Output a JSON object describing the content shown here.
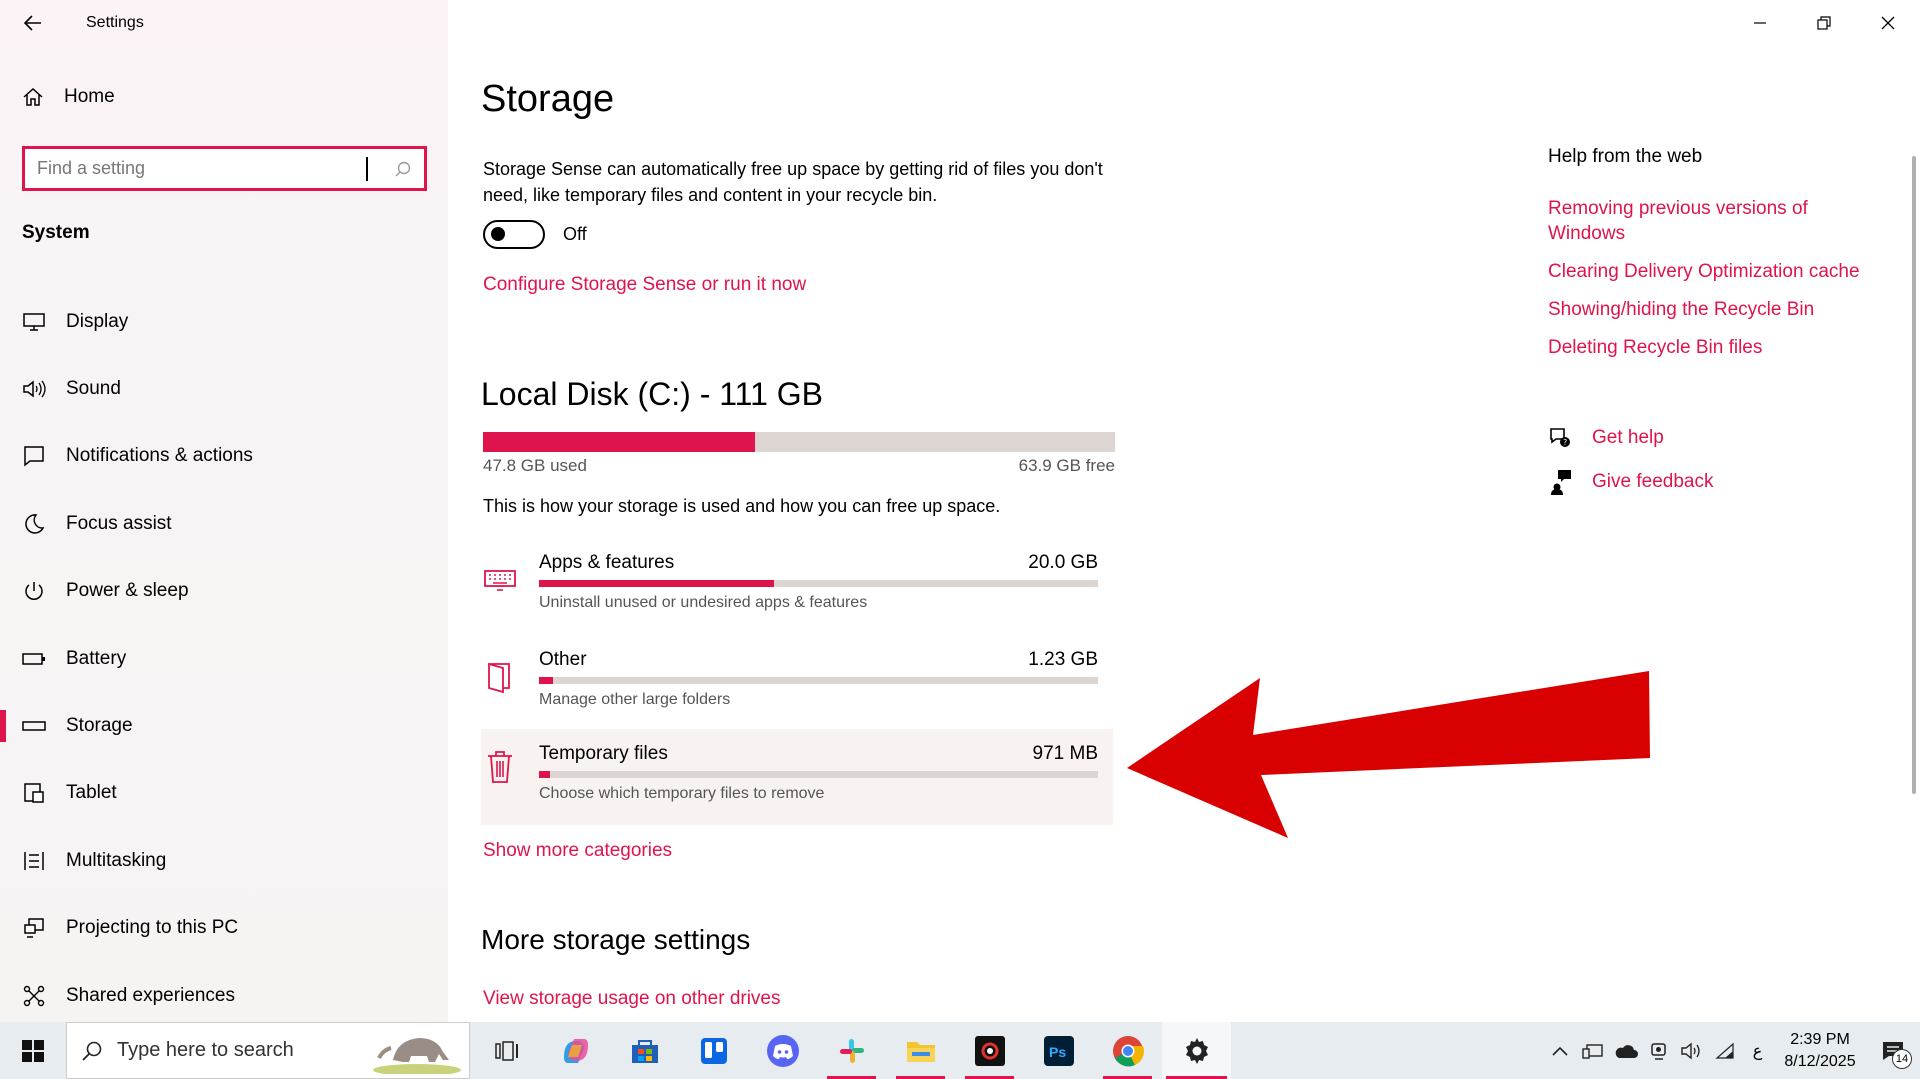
{
  "window": {
    "title": "Settings"
  },
  "sidebar": {
    "home_label": "Home",
    "search_placeholder": "Find a setting",
    "section_title": "System",
    "items": [
      {
        "label": "Display",
        "icon": "monitor-icon"
      },
      {
        "label": "Sound",
        "icon": "speaker-icon"
      },
      {
        "label": "Notifications & actions",
        "icon": "notification-icon"
      },
      {
        "label": "Focus assist",
        "icon": "moon-icon"
      },
      {
        "label": "Power & sleep",
        "icon": "power-icon"
      },
      {
        "label": "Battery",
        "icon": "battery-icon"
      },
      {
        "label": "Storage",
        "icon": "storage-icon",
        "active": true
      },
      {
        "label": "Tablet",
        "icon": "tablet-icon"
      },
      {
        "label": "Multitasking",
        "icon": "multitasking-icon"
      },
      {
        "label": "Projecting to this PC",
        "icon": "projecting-icon"
      },
      {
        "label": "Shared experiences",
        "icon": "shared-icon"
      }
    ]
  },
  "main": {
    "title": "Storage",
    "storage_sense_desc": "Storage Sense can automatically free up space by getting rid of files you don't need, like temporary files and content in your recycle bin.",
    "toggle_state": "Off",
    "configure_link": "Configure Storage Sense or run it now",
    "disk": {
      "title": "Local Disk (C:) - 111 GB",
      "used_label": "47.8 GB used",
      "free_label": "63.9 GB free",
      "used_fraction": 0.43
    },
    "usage_desc": "This is how your storage is used and how you can free up space.",
    "categories": [
      {
        "name": "Apps & features",
        "size": "20.0 GB",
        "desc": "Uninstall unused or undesired apps & features",
        "fraction": 0.42,
        "icon": "keyboard-icon"
      },
      {
        "name": "Other",
        "size": "1.23 GB",
        "desc": "Manage other large folders",
        "fraction": 0.025,
        "icon": "folder-icon"
      },
      {
        "name": "Temporary files",
        "size": "971 MB",
        "desc": "Choose which temporary files to remove",
        "fraction": 0.02,
        "icon": "trash-icon"
      }
    ],
    "show_more": "Show more categories",
    "more_title": "More storage settings",
    "view_other_drives": "View storage usage on other drives"
  },
  "help": {
    "title": "Help from the web",
    "links": [
      "Removing previous versions of Windows",
      "Clearing Delivery Optimization cache",
      "Showing/hiding the Recycle Bin",
      "Deleting Recycle Bin files"
    ],
    "get_help": "Get help",
    "give_feedback": "Give feedback"
  },
  "taskbar": {
    "search_placeholder": "Type here to search",
    "apps": [
      "task-view-icon",
      "copilot-icon",
      "store-icon",
      "trello-icon",
      "discord-icon",
      "slack-icon",
      "file-explorer-icon",
      "davinci-icon",
      "photoshop-icon",
      "chrome-icon",
      "settings-icon"
    ],
    "time": "2:39 PM",
    "date": "8/12/2025",
    "ime": "ع",
    "notification_count": "14"
  },
  "colors": {
    "accent": "#e0144c",
    "arrow": "#d80000",
    "bar_track": "#ddd5d2"
  }
}
